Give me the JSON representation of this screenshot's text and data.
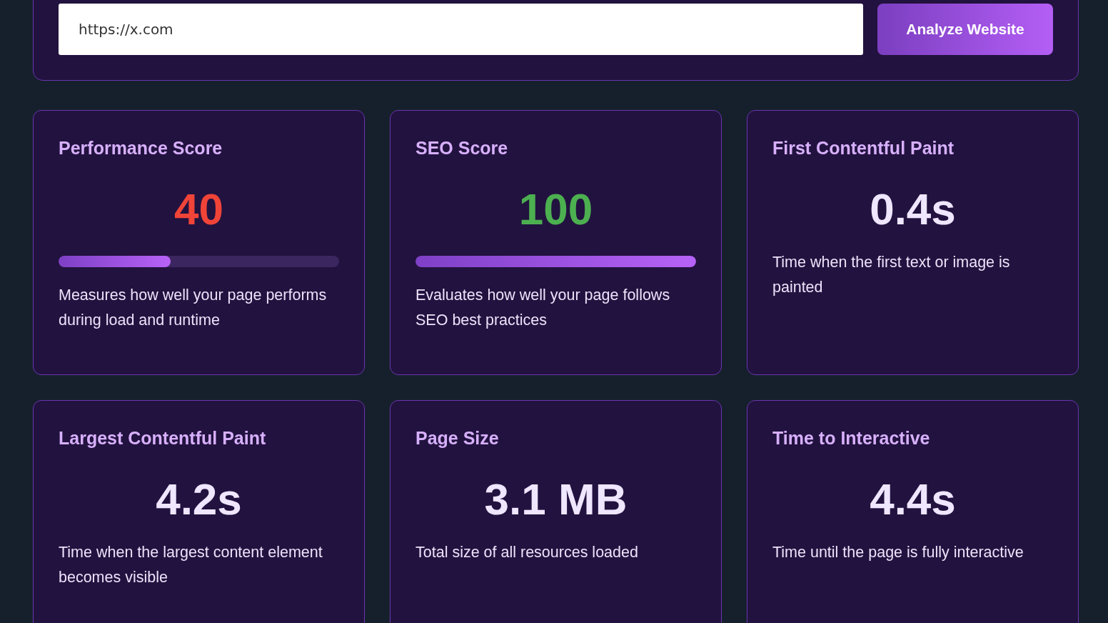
{
  "url_field": {
    "value": "https://x.com"
  },
  "analyze_button": {
    "label": "Analyze Website"
  },
  "metrics": [
    {
      "title": "Performance Score",
      "value": "40",
      "color": "#f04438",
      "level": 0.4,
      "description": "Measures how well your page performs during load and runtime"
    },
    {
      "title": "SEO Score",
      "value": "100",
      "color": "#4caf50",
      "level": 1.0,
      "description": "Evaluates how well your page follows SEO best practices"
    },
    {
      "title": "First Contentful Paint",
      "value": "0.4s",
      "color": "#efe6ff",
      "description": "Time when the first text or image is painted"
    },
    {
      "title": "Largest Contentful Paint",
      "value": "4.2s",
      "color": "#efe6ff",
      "description": "Time when the largest content element becomes visible"
    },
    {
      "title": "Page Size",
      "value": "3.1 MB",
      "color": "#efe6ff",
      "description": "Total size of all resources loaded"
    },
    {
      "title": "Time to Interactive",
      "value": "4.4s",
      "color": "#efe6ff",
      "description": "Time until the page is fully interactive"
    }
  ]
}
